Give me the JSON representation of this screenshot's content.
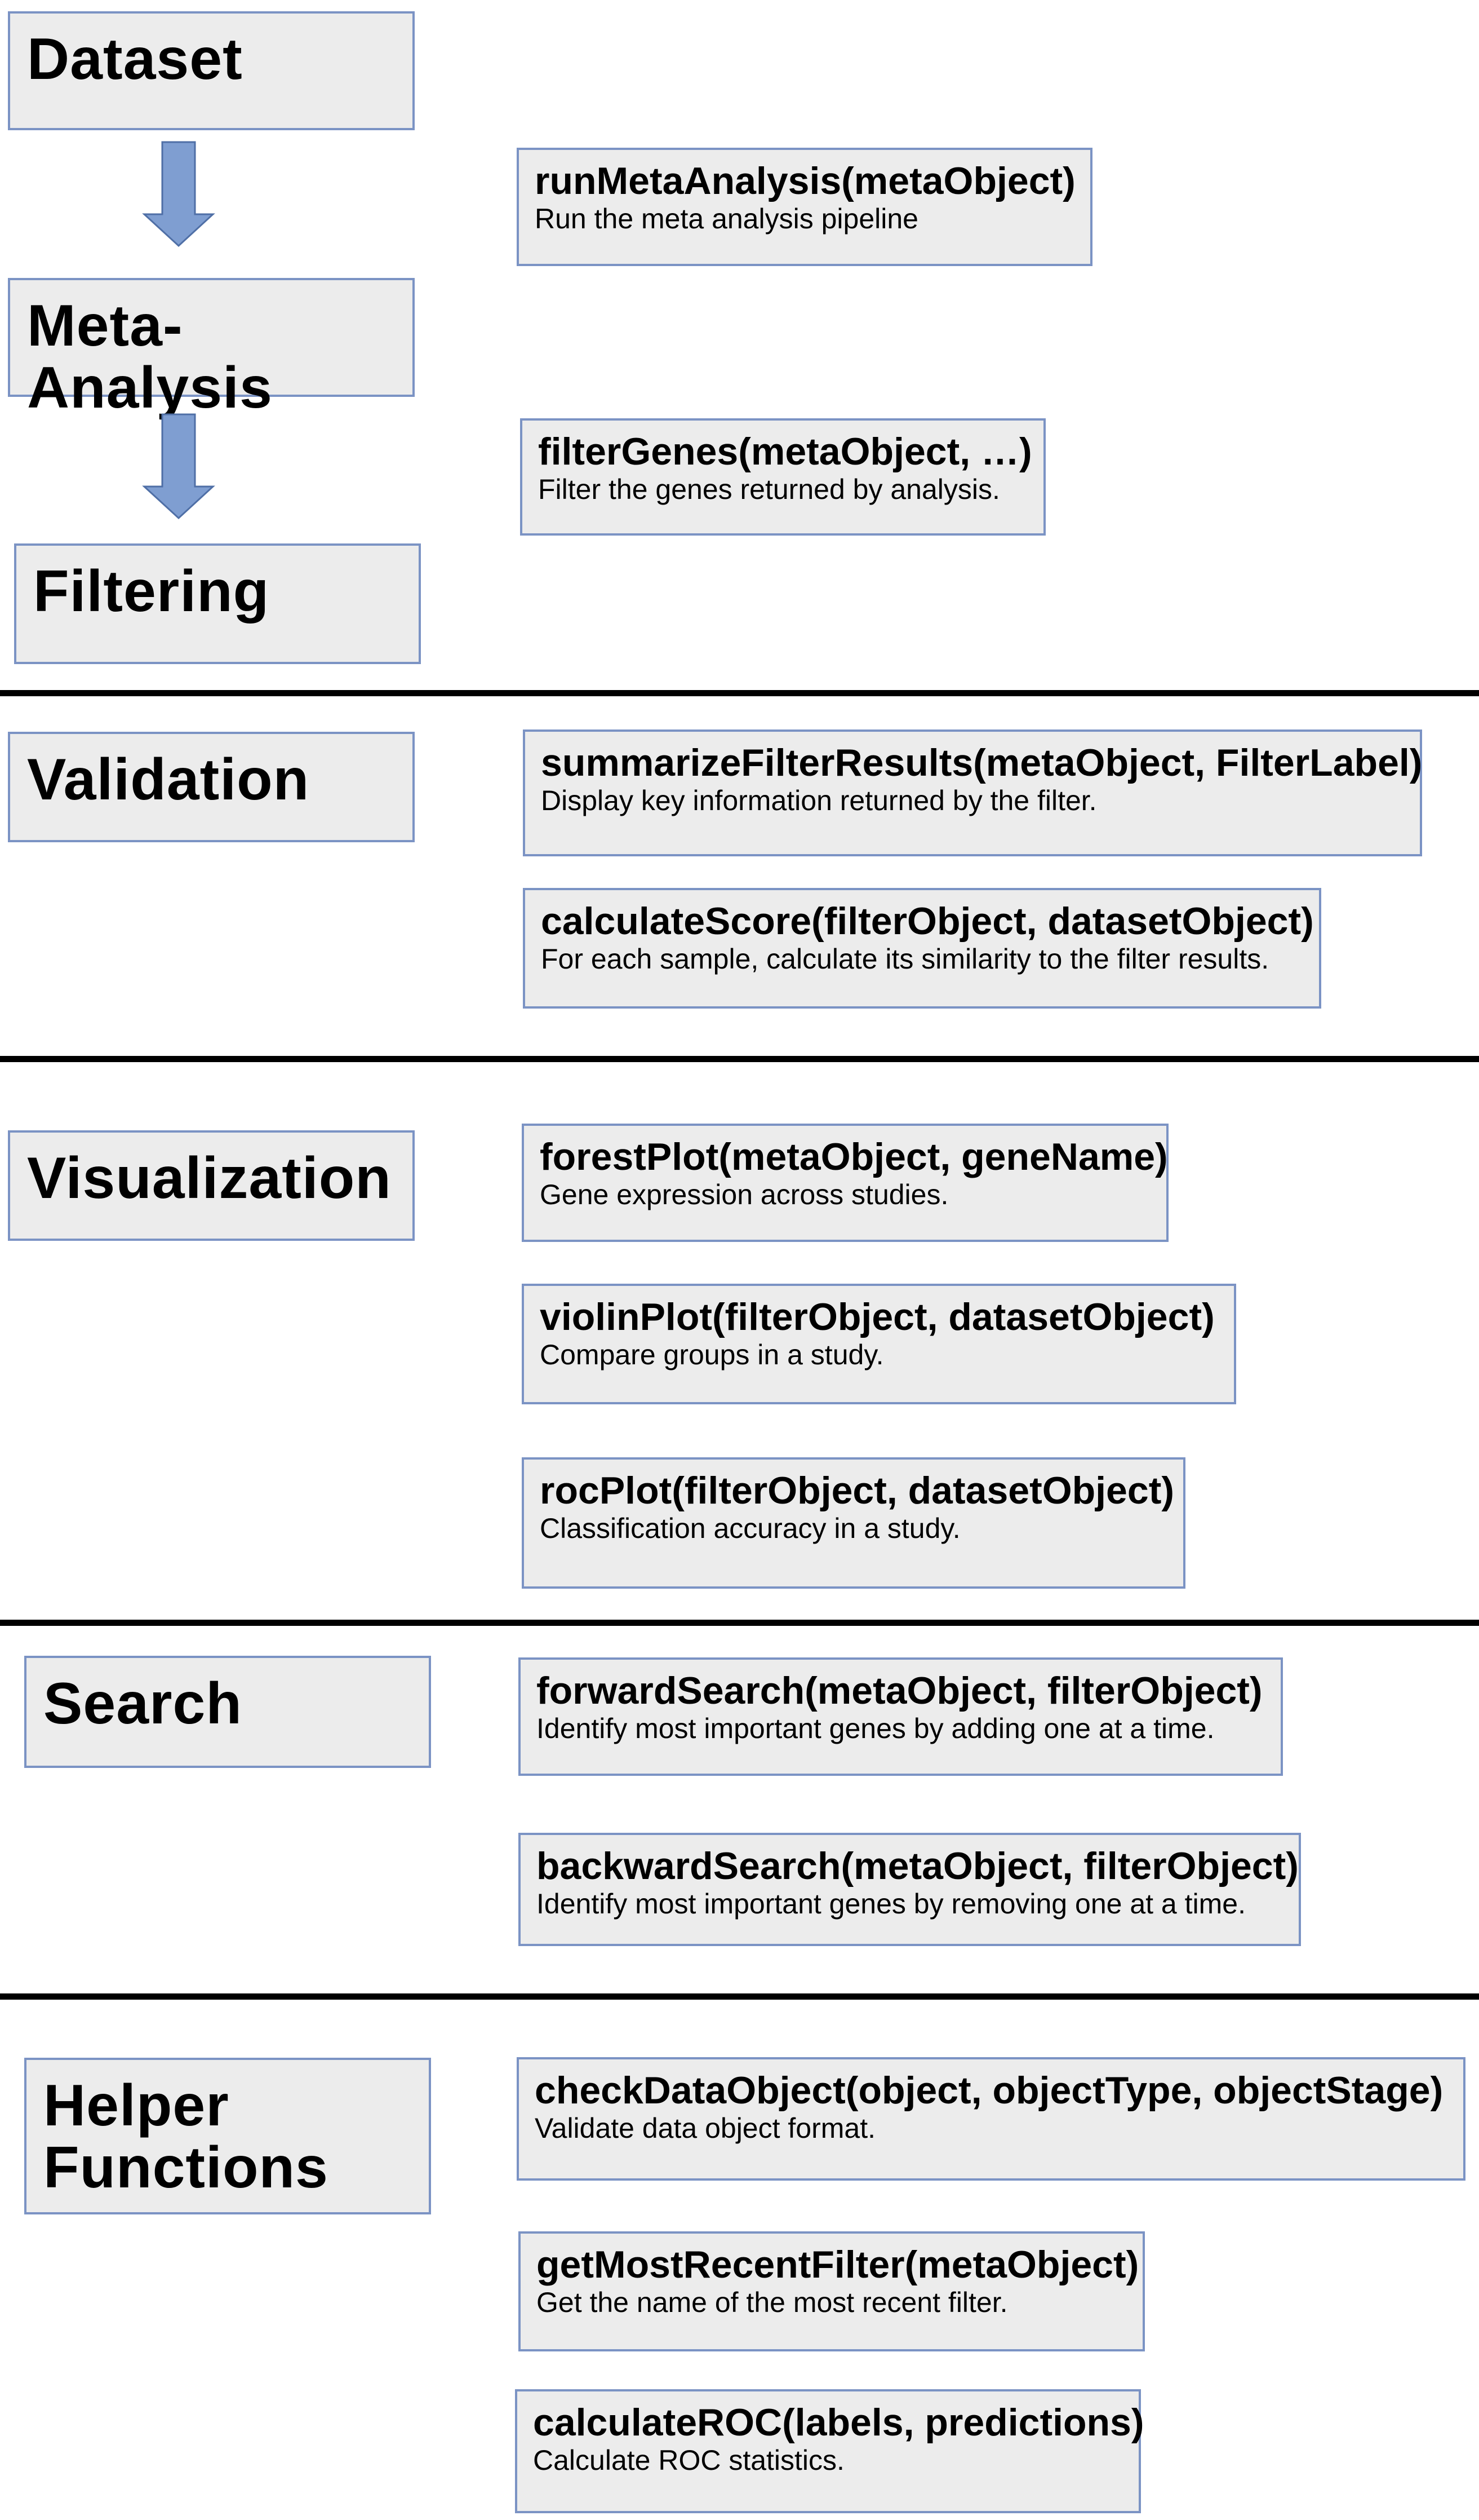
{
  "pipeline": {
    "dataset": "Dataset",
    "meta_analysis": "Meta-Analysis",
    "filtering": "Filtering"
  },
  "sections": {
    "validation": "Validation",
    "visualization": "Visualization",
    "search": "Search",
    "helper_functions": "Helper\nFunctions"
  },
  "functions": {
    "run_meta_analysis": {
      "name": "runMetaAnalysis(metaObject)",
      "desc": "Run the meta analysis pipeline"
    },
    "filter_genes": {
      "name": "filterGenes(metaObject, …)",
      "desc": "Filter the genes returned by analysis."
    },
    "summarize_filter_results": {
      "name": "summarizeFilterResults(metaObject, FilterLabel)",
      "desc": "Display key information returned by the filter."
    },
    "calculate_score": {
      "name": "calculateScore(filterObject, datasetObject)",
      "desc": "For each sample, calculate its similarity to the filter results."
    },
    "forest_plot": {
      "name": "forestPlot(metaObject, geneName)",
      "desc": "Gene expression across studies."
    },
    "violin_plot": {
      "name": "violinPlot(filterObject, datasetObject)",
      "desc": "Compare groups in a study."
    },
    "roc_plot": {
      "name": "rocPlot(filterObject, datasetObject)",
      "desc": "Classification accuracy in a study."
    },
    "forward_search": {
      "name": "forwardSearch(metaObject, filterObject)",
      "desc": "Identify most important genes by adding one at a time."
    },
    "backward_search": {
      "name": "backwardSearch(metaObject, filterObject)",
      "desc": "Identify most important genes by removing one at a time."
    },
    "check_data_object": {
      "name": "checkDataObject(object, objectType, objectStage)",
      "desc": "Validate data object format."
    },
    "get_most_recent_filter": {
      "name": "getMostRecentFilter(metaObject)",
      "desc": "Get the name of the most recent filter."
    },
    "calculate_roc": {
      "name": "calculateROC(labels, predictions)",
      "desc": "Calculate ROC statistics."
    }
  },
  "colors": {
    "box_fill": "#ececec",
    "box_border": "#7b93c4",
    "arrow_fill": "#7f9ed1",
    "arrow_stroke": "#4f6fa6",
    "divider": "#000000"
  }
}
